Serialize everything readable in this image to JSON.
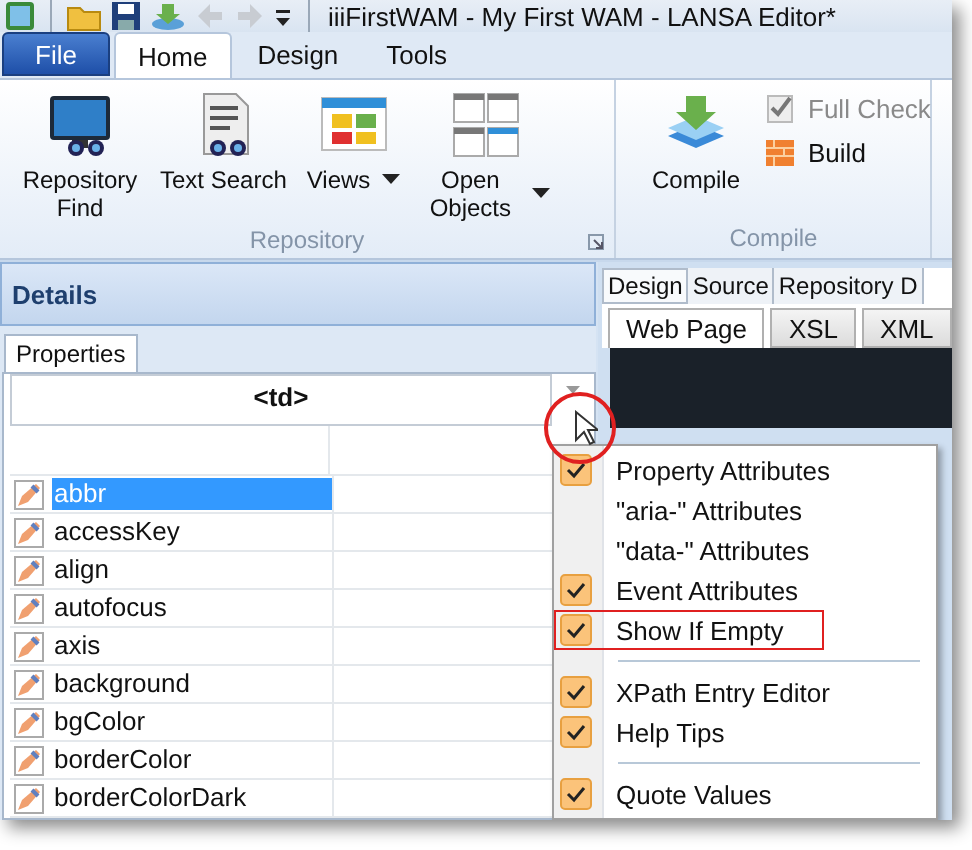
{
  "window": {
    "title": "iiiFirstWAM - My First WAM - LANSA Editor*"
  },
  "ribbon": {
    "file_tab": "File",
    "tabs": [
      {
        "label": "Home",
        "selected": true
      },
      {
        "label": "Design",
        "selected": false
      },
      {
        "label": "Tools",
        "selected": false
      }
    ],
    "groups": [
      {
        "label": "Repository",
        "large_buttons": [
          {
            "label": "Repository Find",
            "dropdown": false
          },
          {
            "label": "Text Search",
            "dropdown": false
          },
          {
            "label": "Views",
            "dropdown": true
          },
          {
            "label": "Open Objects",
            "dropdown": true
          }
        ]
      },
      {
        "label": "Compile",
        "large_buttons": [
          {
            "label": "Compile",
            "dropdown": false
          }
        ],
        "small_buttons": [
          {
            "label": "Full Check",
            "disabled": true
          },
          {
            "label": "Build",
            "disabled": false
          }
        ]
      }
    ]
  },
  "details": {
    "title": "Details",
    "tabs": [
      {
        "label": "Properties",
        "selected": true
      }
    ],
    "element": "<td>",
    "properties": [
      {
        "name": "abbr",
        "selected": true
      },
      {
        "name": "accessKey",
        "selected": false
      },
      {
        "name": "align",
        "selected": false
      },
      {
        "name": "autofocus",
        "selected": false
      },
      {
        "name": "axis",
        "selected": false
      },
      {
        "name": "background",
        "selected": false
      },
      {
        "name": "bgColor",
        "selected": false
      },
      {
        "name": "borderColor",
        "selected": false
      },
      {
        "name": "borderColorDark",
        "selected": false
      }
    ]
  },
  "editor": {
    "tabs": [
      {
        "label": "Design",
        "selected": true
      },
      {
        "label": "Source",
        "selected": false
      },
      {
        "label": "Repository D",
        "selected": false
      }
    ],
    "subtabs": [
      {
        "label": "Web Page",
        "selected": true
      },
      {
        "label": "XSL",
        "selected": false
      },
      {
        "label": "XML",
        "selected": false
      }
    ]
  },
  "context_menu": {
    "items": [
      {
        "kind": "item",
        "label": "Property Attributes",
        "checked": true,
        "highlighted": false
      },
      {
        "kind": "item",
        "label": "\"aria-\" Attributes",
        "checked": false,
        "highlighted": false
      },
      {
        "kind": "item",
        "label": "\"data-\" Attributes",
        "checked": false,
        "highlighted": false
      },
      {
        "kind": "item",
        "label": "Event Attributes",
        "checked": true,
        "highlighted": false
      },
      {
        "kind": "item",
        "label": "Show If Empty",
        "checked": true,
        "highlighted": true
      },
      {
        "kind": "separator"
      },
      {
        "kind": "item",
        "label": "XPath Entry Editor",
        "checked": true,
        "highlighted": false
      },
      {
        "kind": "item",
        "label": "Help Tips",
        "checked": true,
        "highlighted": false
      },
      {
        "kind": "separator"
      },
      {
        "kind": "item",
        "label": "Quote Values",
        "checked": true,
        "highlighted": false
      }
    ]
  }
}
